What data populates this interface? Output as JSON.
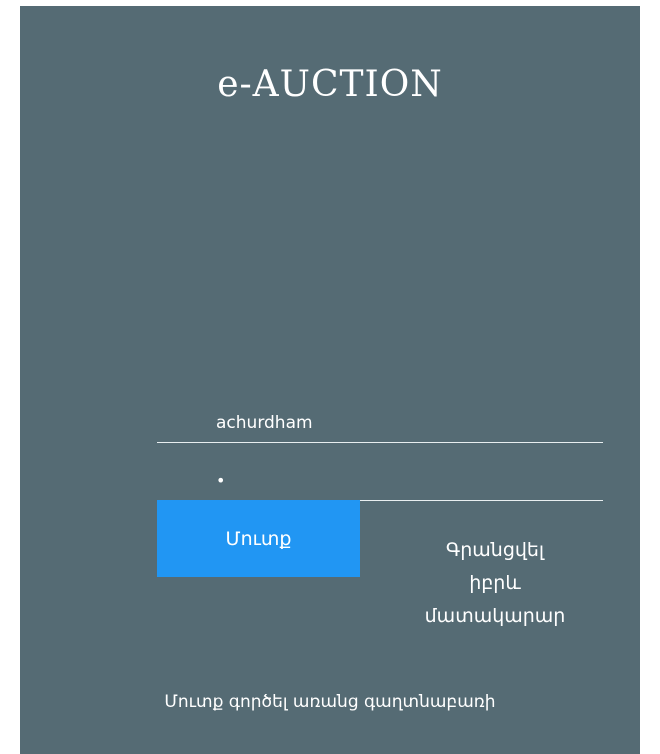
{
  "app": {
    "brand": "e-AUCTION"
  },
  "login_form": {
    "username_value": "achurdham",
    "password_value": "•",
    "submit_label": "Մուտք",
    "register_label": "Գրանցվել\nիբրև\nմատակարար",
    "guest_label": "Մուտք գործել առանց գաղտնաբառի"
  },
  "colors": {
    "panel_background": "#556b74",
    "primary_button": "#2196f3",
    "text": "#ffffff"
  }
}
